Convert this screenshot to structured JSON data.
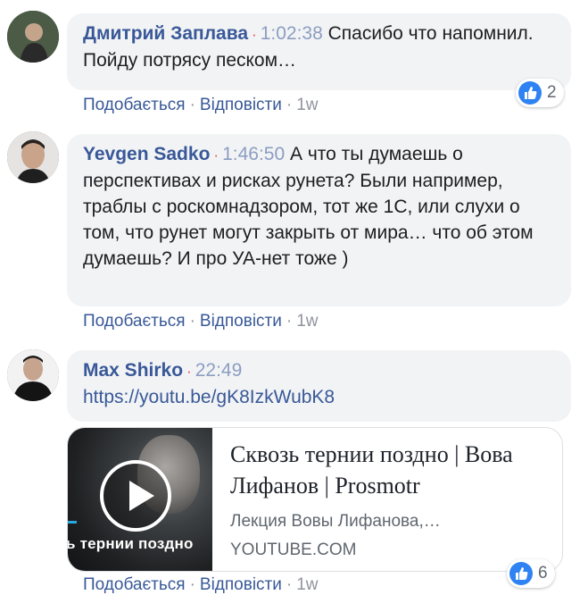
{
  "comments": [
    {
      "author": "Дмитрий Заплава",
      "separator": "·",
      "timestamp": "1:02:38",
      "text": "Спасибо что напомнил. Пойду потрясу песком…",
      "actions": {
        "like": "Подобається",
        "reply": "Відповісти",
        "age": "1w"
      },
      "reactions": "2"
    },
    {
      "author": "Yevgen Sadko",
      "separator": "·",
      "timestamp": "1:46:50",
      "text": "А что ты думаешь о перспективах и рисках рунета? Были например, траблы с роскомнадзором, тот же 1С, или слухи о том, что рунет могут закрыть от мира… что об этом думаешь? И про УА-нет тоже )",
      "actions": {
        "like": "Подобається",
        "reply": "Відповісти",
        "age": "1w"
      }
    },
    {
      "author": "Max Shirko",
      "separator": "·",
      "timestamp": "22:49",
      "link": "https://youtu.be/gK8IzkWubK8",
      "preview": {
        "title": "Сквозь тернии поздно | Вова Лифанов | Prosmotr",
        "description": "Лекция Вовы Лифанова,…",
        "domain": "YOUTUBE.COM",
        "thumb_caption": "ь тернии поздно"
      },
      "actions": {
        "like": "Подобається",
        "reply": "Відповісти",
        "age": "1w"
      },
      "reactions": "6"
    }
  ],
  "icons": {
    "reaction": "like-thumb-icon",
    "play": "play-icon"
  },
  "colors": {
    "author": "#385898",
    "bubble": "#f2f3f5",
    "like_badge": "#2f82f1"
  }
}
